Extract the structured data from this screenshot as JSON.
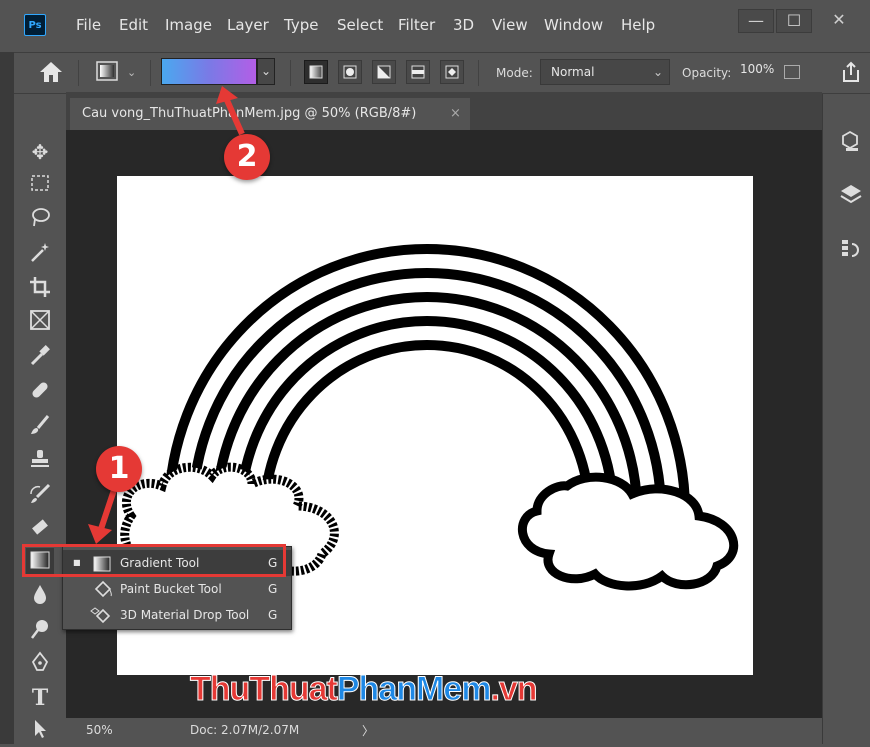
{
  "app": {
    "logo_text": "Ps",
    "menu": [
      "File",
      "Edit",
      "Image",
      "Layer",
      "Type",
      "Select",
      "Filter",
      "3D",
      "View",
      "Window",
      "Help"
    ],
    "window_controls": [
      "—",
      "☐",
      "✕"
    ]
  },
  "options_bar": {
    "mode_label": "Mode:",
    "mode_value": "Normal",
    "opacity_label": "Opacity:",
    "opacity_value": "100%",
    "gradient_colors": [
      "#4aa8ef",
      "#7a7ae6",
      "#b35ee6"
    ],
    "gradient_types": [
      "linear",
      "radial",
      "angle",
      "reflected",
      "diamond"
    ]
  },
  "document": {
    "tab_title": "Cau vong_ThuThuatPhanMem.jpg @ 50% (RGB/8#)",
    "tab_close": "×",
    "zoom": "50%",
    "doc_info": "Doc: 2.07M/2.07M",
    "status_arrow": "〉"
  },
  "toolbar": {
    "tools": [
      "move-tool",
      "marquee-tool",
      "lasso-tool",
      "magic-wand-tool",
      "crop-tool",
      "frame-tool",
      "eyedropper-tool",
      "healing-brush-tool",
      "brush-tool",
      "clone-stamp-tool",
      "history-brush-tool",
      "eraser-tool",
      "gradient-tool",
      "blur-tool",
      "dodge-tool",
      "pen-tool",
      "type-tool",
      "path-selection-tool"
    ],
    "type_tool_glyph": "T"
  },
  "flyout": {
    "items": [
      {
        "label": "Gradient Tool",
        "key": "G",
        "selected": true
      },
      {
        "label": "Paint Bucket Tool",
        "key": "G",
        "selected": false
      },
      {
        "label": "3D Material Drop Tool",
        "key": "G",
        "selected": false
      }
    ]
  },
  "annotations": {
    "badge_1": "1",
    "badge_2": "2",
    "accent": "#e53935"
  },
  "watermark": {
    "part1": "ThuThuat",
    "part2": "PhanMem",
    "part3": ".vn",
    "color1": "#e53935",
    "color2": "#1e88e5"
  }
}
